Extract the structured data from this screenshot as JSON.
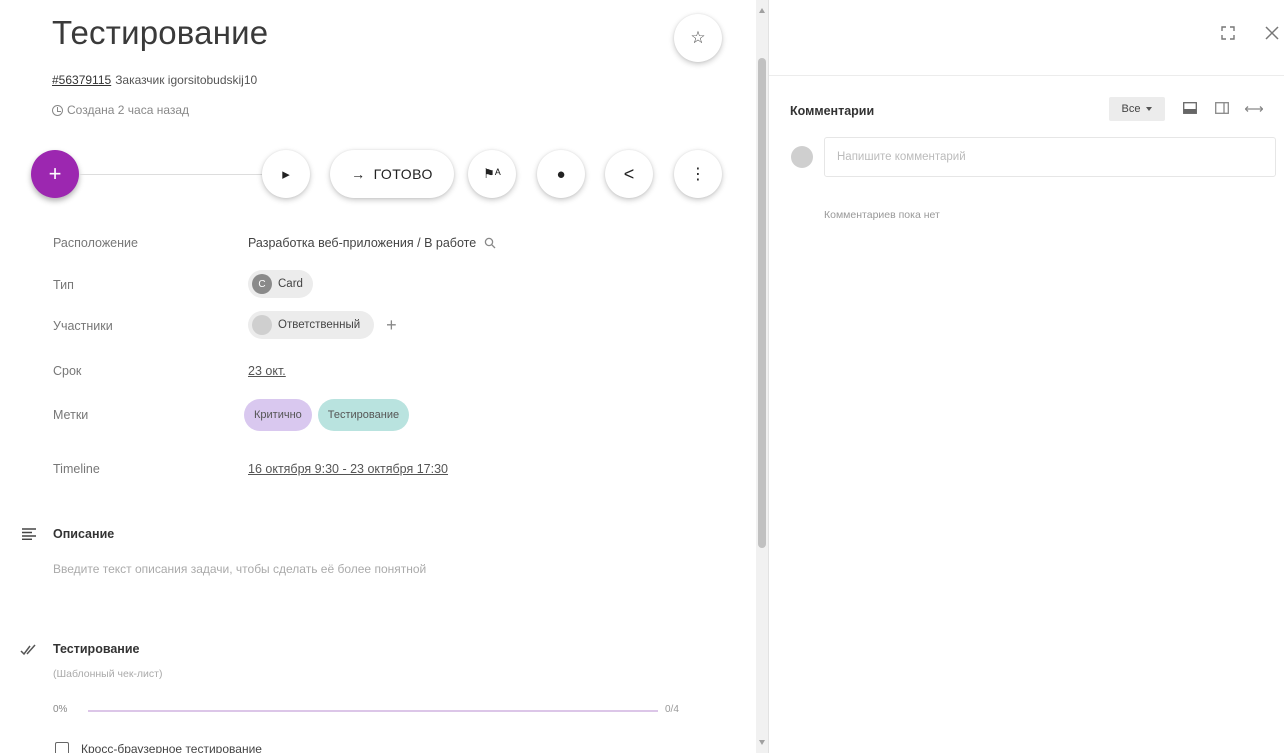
{
  "task": {
    "title": "Тестирование",
    "number": "#56379115",
    "customer": "Заказчик igorsitobudskij10",
    "created": "Создана 2 часа назад"
  },
  "toolbar": {
    "add": "+",
    "play": "▸",
    "done_arrow": "→",
    "done_label": "ГОТОВО",
    "flag": "⚑ᴬ",
    "info": "●",
    "share": "<",
    "more": "⋮",
    "star": "☆"
  },
  "fields": {
    "location_label": "Расположение",
    "location_value": "Разработка веб-приложения / В работе",
    "type_label": "Тип",
    "type_avatar": "C",
    "type_value": "Card",
    "members_label": "Участники",
    "members_value": "Ответственный",
    "members_add": "+",
    "due_label": "Срок",
    "due_value": "23 окт.",
    "tags_label": "Метки",
    "tags": [
      "Критично",
      "Тестирование"
    ],
    "timeline_label": "Timeline",
    "timeline_value": "16 октября 9:30 - 23 октября 17:30"
  },
  "description": {
    "title": "Описание",
    "placeholder": "Введите текст описания задачи, чтобы сделать её более понятной"
  },
  "checklist": {
    "title": "Тестирование",
    "subtitle": "(Шаблонный чек-лист)",
    "percent": "0%",
    "progress": 0,
    "count": "0/4",
    "first_item": "Кросс-браузерное тестирование"
  },
  "comments": {
    "title": "Комментарии",
    "filter": "Все",
    "placeholder": "Напишите комментарий",
    "empty": "Комментариев пока нет"
  },
  "colors": {
    "accent": "#9c27b0",
    "tag_purple": "#d9c8ef",
    "tag_teal": "#b9e3df"
  }
}
